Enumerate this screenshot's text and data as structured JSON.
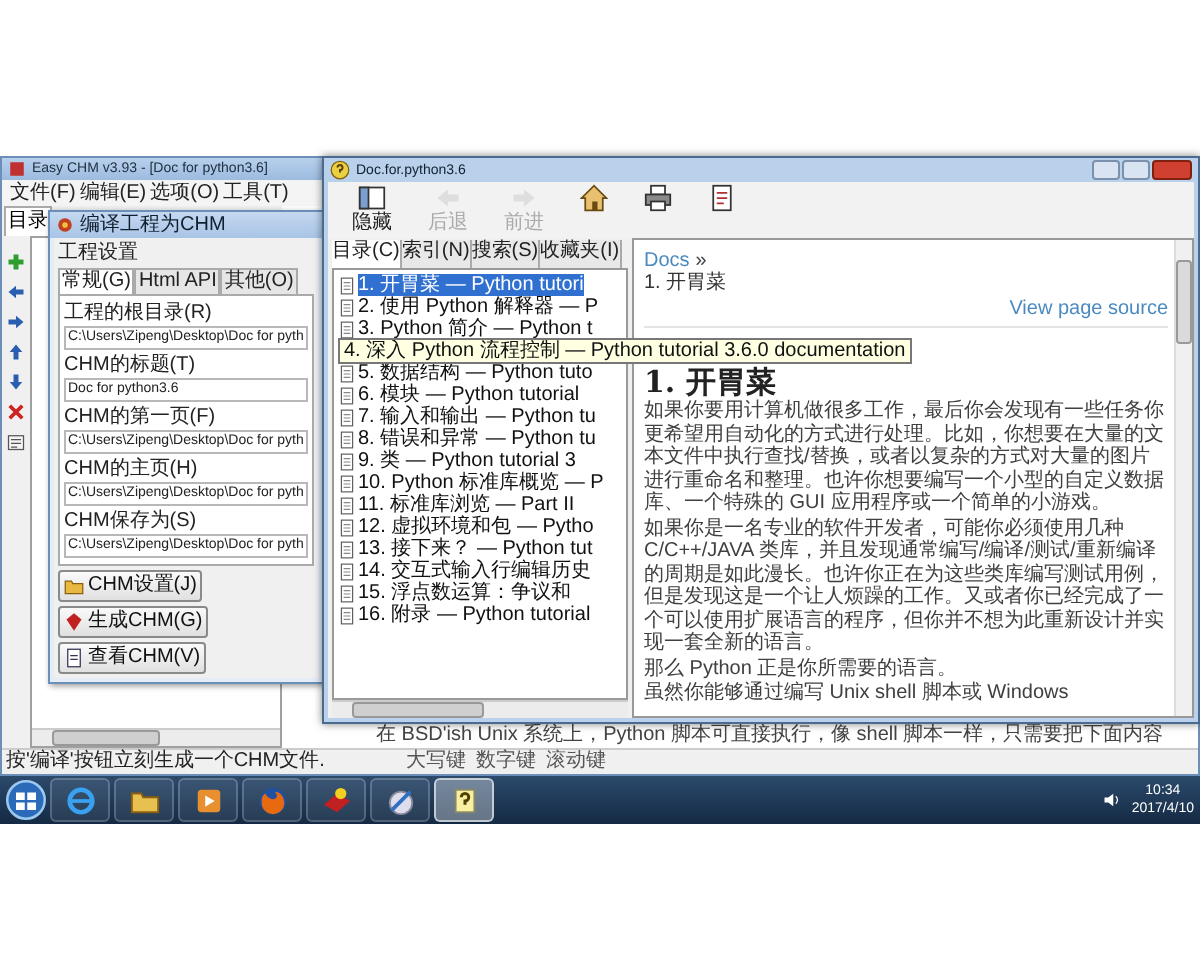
{
  "main_window": {
    "title": "Easy CHM v3.93 - [Doc for python3.6]",
    "menu": [
      "文件(F)",
      "编辑(E)",
      "选项(O)",
      "工具(T)"
    ],
    "pane_tab": "目录",
    "side_tools": [
      {
        "kind": "add"
      },
      {
        "kind": "left"
      },
      {
        "kind": "right"
      },
      {
        "kind": "up"
      },
      {
        "kind": "down"
      },
      {
        "kind": "delete"
      },
      {
        "kind": "properties"
      }
    ],
    "body_line": "在 BSD'ish Unix 系统上，Python 脚本可直接执行，像 shell 脚本一样，只需要把下面内容",
    "status_bar": {
      "message": "按'编译'按钮立刻生成一个CHM文件.",
      "keys": [
        "大写键",
        "数字键",
        "滚动键"
      ]
    }
  },
  "compile_dialog": {
    "title": "编译工程为CHM",
    "group": "工程设置",
    "tabs": [
      {
        "label": "常规(G)",
        "selected": true
      },
      {
        "label": "Html API",
        "selected": false
      },
      {
        "label": "其他(O)",
        "selected": false
      }
    ],
    "fields": [
      {
        "label": "工程的根目录(R)",
        "value": "C:\\Users\\Zipeng\\Desktop\\Doc for pyth"
      },
      {
        "label": "CHM的标题(T)",
        "value": "Doc for python3.6"
      },
      {
        "label": "CHM的第一页(F)",
        "value": "C:\\Users\\Zipeng\\Desktop\\Doc for pyth"
      },
      {
        "label": "CHM的主页(H)",
        "value": "C:\\Users\\Zipeng\\Desktop\\Doc for pyth"
      },
      {
        "label": "CHM保存为(S)",
        "value": "C:\\Users\\Zipeng\\Desktop\\Doc for pyth"
      }
    ],
    "buttons": [
      {
        "kind": "settings",
        "label": "CHM设置(J)"
      },
      {
        "kind": "build",
        "label": "生成CHM(G)"
      },
      {
        "kind": "view",
        "label": "查看CHM(V)"
      }
    ]
  },
  "viewer": {
    "title": "Doc.for.python3.6",
    "toolbar": [
      {
        "kind": "hide",
        "label": "隐藏",
        "disabled": false
      },
      {
        "kind": "back",
        "label": "后退",
        "disabled": true
      },
      {
        "kind": "forward",
        "label": "前进",
        "disabled": true
      },
      {
        "kind": "home",
        "disabled": false
      },
      {
        "kind": "print",
        "disabled": false
      },
      {
        "kind": "options",
        "disabled": false
      }
    ],
    "tabs": [
      {
        "label": "目录(C)",
        "selected": true
      },
      {
        "label": "索引(N)",
        "selected": false
      },
      {
        "label": "搜索(S)",
        "selected": false
      },
      {
        "label": "收藏夹(I)",
        "selected": false
      }
    ],
    "contents": [
      {
        "text": "1. 开胃菜 — Python tutori",
        "selected": true,
        "hovered": false
      },
      {
        "text": "2. 使用 Python 解释器 — P",
        "selected": false,
        "hovered": false
      },
      {
        "text": "3. Python 简介 — Python t",
        "selected": false,
        "hovered": false
      },
      {
        "text": "4. 深入 Python 流程控制 — Python tutorial 3.6.0 documentation",
        "selected": false,
        "hovered": true
      },
      {
        "text": "5. 数据结构 — Python tuto",
        "selected": false,
        "hovered": false
      },
      {
        "text": "6. 模块 — Python tutorial",
        "selected": false,
        "hovered": false
      },
      {
        "text": "7. 输入和输出 — Python tu",
        "selected": false,
        "hovered": false
      },
      {
        "text": "8. 错误和异常 — Python tu",
        "selected": false,
        "hovered": false
      },
      {
        "text": "9. 类 — Python tutorial 3",
        "selected": false,
        "hovered": false
      },
      {
        "text": "10. Python 标准库概览 — P",
        "selected": false,
        "hovered": false
      },
      {
        "text": "11. 标准库浏览 — Part II",
        "selected": false,
        "hovered": false
      },
      {
        "text": "12. 虚拟环境和包 — Pytho",
        "selected": false,
        "hovered": false
      },
      {
        "text": "13. 接下来？ — Python tut",
        "selected": false,
        "hovered": false
      },
      {
        "text": "14. 交互式输入行编辑历史",
        "selected": false,
        "hovered": false
      },
      {
        "text": "15. 浮点数运算：争议和",
        "selected": false,
        "hovered": false
      },
      {
        "text": "16. 附录 — Python tutorial",
        "selected": false,
        "hovered": false
      }
    ],
    "page": {
      "breadcrumb_link": "Docs",
      "breadcrumb_separator": "»",
      "breadcrumb_current": "1. 开胃菜",
      "source_link": "View page source",
      "heading": "1. 开胃菜",
      "paragraphs": [
        "如果你要用计算机做很多工作，最后你会发现有一些任务你更希望用自动化的方式进行处理。比如，你想要在大量的文本文件中执行查找/替换，或者以复杂的方式对大量的图片进行重命名和整理。也许你想要编写一个小型的自定义数据库、一个特殊的 GUI 应用程序或一个简单的小游戏。",
        "如果你是一名专业的软件开发者，可能你必须使用几种 C/C++/JAVA 类库，并且发现通常编写/编译/测试/重新编译的周期是如此漫长。也许你正在为这些类库编写测试用例，但是发现这是一个让人烦躁的工作。又或者你已经完成了一个可以使用扩展语言的程序，但你并不想为此重新设计并实现一套全新的语言。",
        "那么 Python 正是你所需要的语言。",
        "虽然你能够通过编写 Unix shell 脚本或 Windows"
      ]
    }
  },
  "taskbar": {
    "apps": [
      {
        "kind": "ie",
        "selected": false
      },
      {
        "kind": "folder",
        "selected": false
      },
      {
        "kind": "media",
        "selected": false
      },
      {
        "kind": "firefox",
        "selected": false
      },
      {
        "kind": "chm-editor",
        "selected": false
      },
      {
        "kind": "paint",
        "selected": false
      },
      {
        "kind": "chm-viewer",
        "selected": true
      }
    ],
    "clock": {
      "time": "10:34",
      "date": "2017/4/10"
    }
  }
}
